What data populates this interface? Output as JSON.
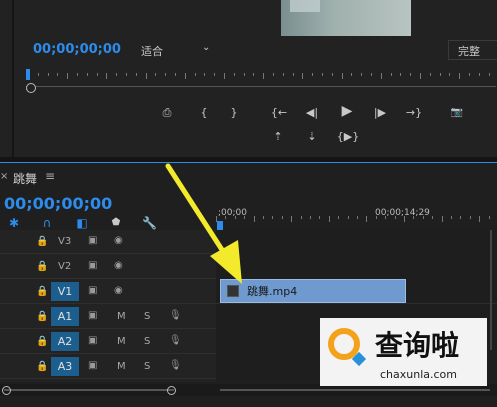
{
  "monitor": {
    "timecode": "00;00;00;00",
    "fit_label": "适合",
    "quality_label": "完整",
    "transport": {
      "export_frame": "⎙",
      "mark_in": "{",
      "mark_out": "}",
      "go_in": "{←",
      "step_back": "◀|",
      "play": "▶",
      "step_fwd": "|▶",
      "go_out": "→}",
      "camera": "📷",
      "lift": "⇡",
      "extract": "⇣",
      "compare": "{▶}"
    }
  },
  "timeline": {
    "sequence_name": "跳舞",
    "menu_icon": "≡",
    "timecode": "00;00;00;00",
    "ruler_start": ";00;00",
    "ruler_end": "00;00;14;29",
    "tracks": {
      "v3": "V3",
      "v2": "V2",
      "v1": "V1",
      "a1": "A1",
      "a2": "A2",
      "a3": "A3",
      "m": "M",
      "s": "S"
    },
    "clip_name": "跳舞.mp4"
  },
  "watermark": {
    "title": "查询啦",
    "url": "chaxunla.com"
  },
  "colors": {
    "accent_blue": "#2d8ceb",
    "clip_fill": "#6f9ad0",
    "arrow_yellow": "#f2ea2a",
    "work_area": "#e8d838"
  }
}
